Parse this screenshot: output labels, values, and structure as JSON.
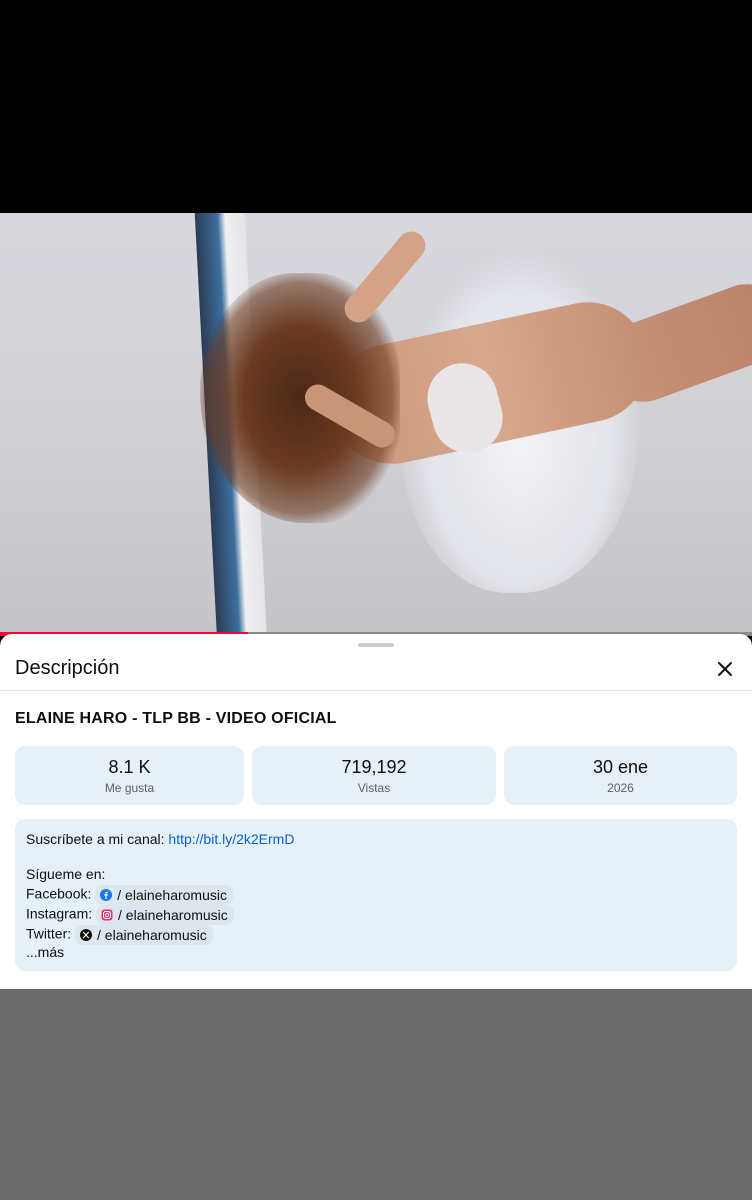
{
  "player": {
    "progress_fraction": 0.33
  },
  "description_sheet": {
    "title": "Descripción",
    "close_icon": "close-icon",
    "video_title": "ELAINE HARO - TLP BB - VIDEO OFICIAL",
    "stats": {
      "likes": {
        "value": "8.1 K",
        "label": "Me gusta"
      },
      "views": {
        "value": "719,192",
        "label": "Vistas"
      },
      "date": {
        "value": "30 ene",
        "label": "2026"
      }
    },
    "description": {
      "subscribe_prefix": "Suscríbete a mi canal: ",
      "subscribe_link": "http://bit.ly/2k2ErmD",
      "follow_heading": "Sígueme en:",
      "socials": [
        {
          "network": "Facebook:",
          "icon": "facebook-icon",
          "handle": "/ elaineharomusic"
        },
        {
          "network": "Instagram:",
          "icon": "instagram-icon",
          "handle": "/ elaineharomusic"
        },
        {
          "network": "Twitter:",
          "icon": "x-icon",
          "handle": "/ elaineharomusic"
        }
      ],
      "more_label": "...más"
    }
  },
  "colors": {
    "progress": "#ff0033",
    "link": "#065fd4",
    "stat_bg": "#e6f1f7"
  }
}
